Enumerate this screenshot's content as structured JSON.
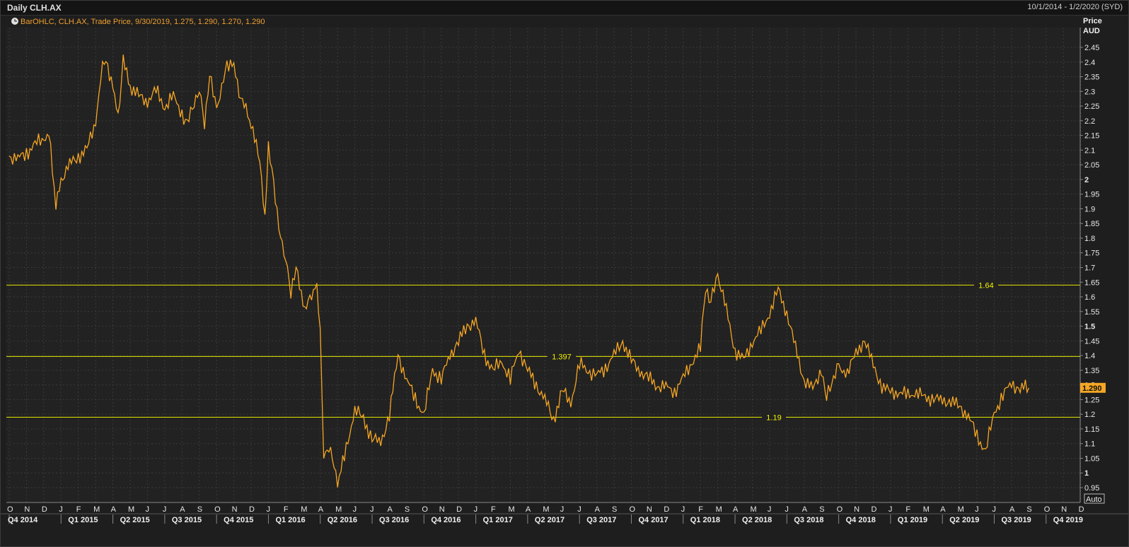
{
  "window": {
    "title": "Daily CLH.AX",
    "date_range": "10/1/2014 - 1/2/2020 (SYD)"
  },
  "legend": {
    "icon": "chart-settings-icon",
    "text": "BarOHLC, CLH.AX, Trade Price, 9/30/2019, 1.275, 1.290, 1.270, 1.290"
  },
  "axis": {
    "y_title_1": "Price",
    "y_title_2": "AUD",
    "last_price": "1.290",
    "auto_button": "Auto"
  },
  "colors": {
    "series": "#f5a623",
    "hline": "#e8e800",
    "grid": "#3a3a3a",
    "last_price_bg": "#f5a623"
  },
  "chart_data": {
    "type": "line",
    "title": "Daily CLH.AX",
    "ylabel": "Price AUD",
    "ylim": [
      0.93,
      2.48
    ],
    "yticks": [
      "2.45",
      "2.4",
      "2.35",
      "2.3",
      "2.25",
      "2.2",
      "2.15",
      "2.1",
      "2.05",
      "2",
      "1.95",
      "1.9",
      "1.85",
      "1.8",
      "1.75",
      "1.7",
      "1.65",
      "1.6",
      "1.55",
      "1.5",
      "1.45",
      "1.4",
      "1.35",
      "1.3",
      "1.25",
      "1.2",
      "1.15",
      "1.1",
      "1.05",
      "1",
      "0.95"
    ],
    "month_ticks": [
      "O",
      "N",
      "D",
      "J",
      "F",
      "M",
      "A",
      "M",
      "J",
      "J",
      "A",
      "S",
      "O",
      "N",
      "D",
      "J",
      "F",
      "M",
      "A",
      "M",
      "J",
      "J",
      "A",
      "S",
      "O",
      "N",
      "D",
      "J",
      "F",
      "M",
      "A",
      "M",
      "J",
      "J",
      "A",
      "S",
      "O",
      "N",
      "D",
      "J",
      "F",
      "M",
      "A",
      "M",
      "J",
      "J",
      "A",
      "S",
      "O",
      "N",
      "D",
      "J",
      "F",
      "M",
      "A",
      "M",
      "J",
      "J",
      "A",
      "S",
      "O",
      "N",
      "D"
    ],
    "quarter_ticks": [
      "Q4 2014",
      "Q1 2015",
      "Q2 2015",
      "Q3 2015",
      "Q4 2015",
      "Q1 2016",
      "Q2 2016",
      "Q3 2016",
      "Q4 2016",
      "Q1 2017",
      "Q2 2017",
      "Q3 2017",
      "Q4 2017",
      "Q1 2018",
      "Q2 2018",
      "Q3 2018",
      "Q4 2018",
      "Q1 2019",
      "Q2 2019",
      "Q3 2019",
      "Q4 2019"
    ],
    "horizontal_lines": [
      {
        "value": 1.64,
        "label": "1.64"
      },
      {
        "value": 1.397,
        "label": "1.397"
      },
      {
        "value": 1.19,
        "label": "1.19"
      }
    ],
    "series": [
      {
        "name": "CLH.AX",
        "x_month_index": [
          0,
          0.5,
          1,
          1.5,
          2,
          2.3,
          2.5,
          2.7,
          3,
          3.5,
          4,
          4.5,
          5,
          5.3,
          5.6,
          6,
          6.3,
          6.6,
          7,
          7.5,
          8,
          8.5,
          9,
          9.5,
          10,
          10.3,
          10.6,
          11,
          11.3,
          11.6,
          12,
          12.3,
          12.6,
          13,
          13.3,
          13.6,
          14,
          14.5,
          14.8,
          15,
          15.3,
          15.6,
          16,
          16.3,
          16.6,
          17,
          17.4,
          17.8,
          18,
          18.2,
          18.5,
          18.8,
          19,
          19.5,
          20,
          20.5,
          21,
          21.5,
          22,
          22.5,
          23,
          23.5,
          24,
          24.5,
          25,
          25.5,
          26,
          26.5,
          27,
          27.5,
          28,
          28.5,
          29,
          29.5,
          30,
          30.5,
          31,
          31.5,
          32,
          32.5,
          33,
          33.5,
          34,
          34.5,
          35,
          35.5,
          36,
          36.5,
          37,
          37.5,
          38,
          38.5,
          39,
          39.5,
          40,
          40.3,
          40.6,
          41,
          41.5,
          42,
          42.5,
          43,
          43.5,
          44,
          44.5,
          45,
          45.5,
          46,
          46.5,
          47,
          47.3,
          47.6,
          48,
          48.5,
          49,
          49.5,
          50,
          50.5,
          51,
          51.5,
          52,
          52.5,
          53,
          53.5,
          54,
          54.5,
          55,
          55.5,
          56,
          56.5,
          57,
          57.5,
          58,
          58.5,
          59
        ],
        "values": [
          2.08,
          2.07,
          2.09,
          2.12,
          2.14,
          2.16,
          2.04,
          1.9,
          2.0,
          2.05,
          2.08,
          2.1,
          2.2,
          2.35,
          2.42,
          2.3,
          2.22,
          2.4,
          2.32,
          2.28,
          2.27,
          2.3,
          2.25,
          2.28,
          2.23,
          2.18,
          2.25,
          2.3,
          2.2,
          2.35,
          2.25,
          2.3,
          2.4,
          2.38,
          2.3,
          2.25,
          2.2,
          2.05,
          1.88,
          2.1,
          2.0,
          1.82,
          1.75,
          1.6,
          1.72,
          1.55,
          1.6,
          1.62,
          1.5,
          1.05,
          1.1,
          1.02,
          0.96,
          1.08,
          1.22,
          1.18,
          1.12,
          1.1,
          1.2,
          1.4,
          1.32,
          1.25,
          1.2,
          1.35,
          1.32,
          1.4,
          1.45,
          1.5,
          1.52,
          1.4,
          1.35,
          1.38,
          1.32,
          1.42,
          1.35,
          1.3,
          1.25,
          1.18,
          1.28,
          1.24,
          1.37,
          1.35,
          1.33,
          1.36,
          1.4,
          1.45,
          1.38,
          1.35,
          1.32,
          1.3,
          1.29,
          1.28,
          1.32,
          1.38,
          1.42,
          1.64,
          1.58,
          1.68,
          1.55,
          1.42,
          1.38,
          1.45,
          1.48,
          1.55,
          1.62,
          1.55,
          1.42,
          1.32,
          1.28,
          1.36,
          1.25,
          1.32,
          1.35,
          1.35,
          1.4,
          1.46,
          1.36,
          1.3,
          1.27,
          1.28,
          1.26,
          1.28,
          1.25,
          1.26,
          1.24,
          1.25,
          1.22,
          1.2,
          1.12,
          1.08,
          1.2,
          1.27,
          1.3,
          1.29,
          1.29
        ]
      }
    ]
  }
}
